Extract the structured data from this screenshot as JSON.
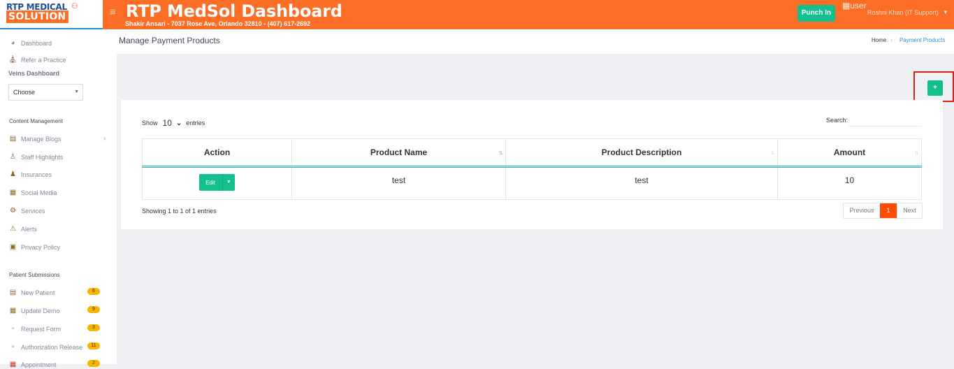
{
  "logo": {
    "line1": "RTP MEDICAL",
    "line2": "SOLUTION"
  },
  "header": {
    "title": "RTP MedSol Dashboard",
    "subtitle": "Shakir Ansari - 7037 Rose Ave, Orlando 32810 - (407) 617-2692",
    "punch_in": "Punch In",
    "user_alt": "user",
    "user_name": "Roshni Khan (IT Support)"
  },
  "sidebar": {
    "dashboard": "Dashboard",
    "refer": "Refer a Practice",
    "veins_heading": "Veins Dashboard",
    "choose": "Choose",
    "content_heading": "Content Management",
    "content_items": [
      "Manage Blogs",
      "Staff Highlights",
      "Insurances",
      "Social Media",
      "Services",
      "Alerts",
      "Privacy Policy"
    ],
    "patient_heading": "Patient Submissions",
    "patient_items": [
      {
        "label": "New Patient",
        "count": "6"
      },
      {
        "label": "Update Demo",
        "count": "9"
      },
      {
        "label": "Request Form",
        "count": "3"
      },
      {
        "label": "Authorization Release",
        "count": "11"
      },
      {
        "label": "Appointment",
        "count": "2"
      }
    ]
  },
  "page": {
    "title": "Manage Payment Products",
    "breadcrumb_home": "Home",
    "breadcrumb_current": "Payment Products",
    "add_label": "+"
  },
  "table": {
    "show_label": "Show",
    "entries_value": "10",
    "entries_label": "entries",
    "search_label": "Search:",
    "columns": [
      "Action",
      "Product Name",
      "Product Description",
      "Amount"
    ],
    "rows": [
      {
        "action": "Edit",
        "name": "test",
        "description": "test",
        "amount": "10"
      }
    ],
    "info": "Showing 1 to 1 of 1 entries",
    "prev": "Previous",
    "current_page": "1",
    "next": "Next"
  },
  "colors": {
    "accent": "#fc6d26",
    "success": "#13c08d",
    "badge": "#f7b500",
    "highlight": "#e21b1b"
  }
}
